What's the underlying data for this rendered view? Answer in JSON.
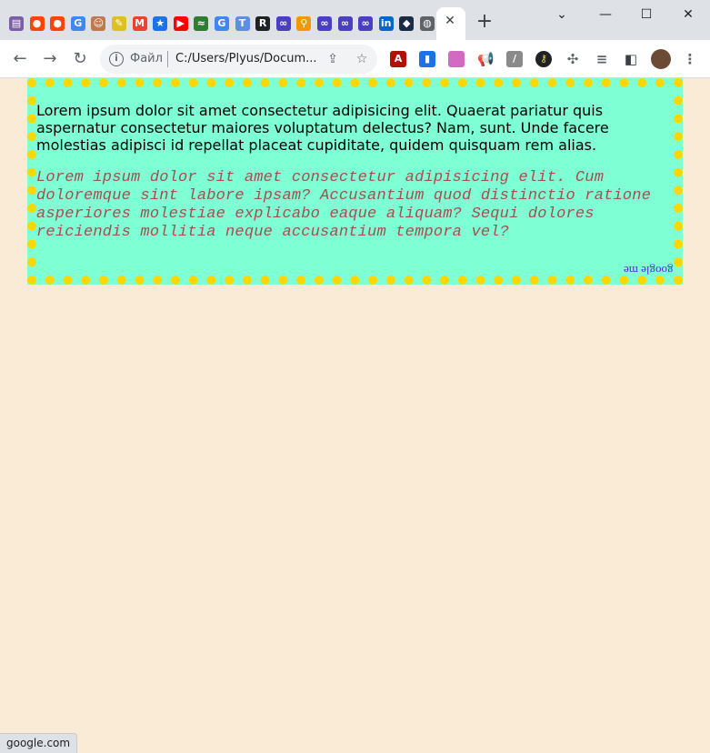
{
  "browser": {
    "tab_count_icons": [
      {
        "name": "library-icon",
        "color": "#7b5ea7",
        "glyph": "▤"
      },
      {
        "name": "reddit-icon",
        "color": "#ff4500",
        "glyph": "●"
      },
      {
        "name": "reddit-icon",
        "color": "#ff4500",
        "glyph": "●"
      },
      {
        "name": "google-icon",
        "color": "#4285f4",
        "glyph": "G"
      },
      {
        "name": "avatar-icon",
        "color": "#c07850",
        "glyph": "☺"
      },
      {
        "name": "chat-icon",
        "color": "#e0c020",
        "glyph": "✎"
      },
      {
        "name": "gmail-icon",
        "color": "#ea4335",
        "glyph": "M"
      },
      {
        "name": "star-icon",
        "color": "#1a73e8",
        "glyph": "★"
      },
      {
        "name": "youtube-icon",
        "color": "#ff0000",
        "glyph": "▶"
      },
      {
        "name": "dna-icon",
        "color": "#2e7d32",
        "glyph": "≈"
      },
      {
        "name": "google-icon",
        "color": "#4285f4",
        "glyph": "G"
      },
      {
        "name": "t-icon",
        "color": "#5c8fe0",
        "glyph": "T"
      },
      {
        "name": "r-icon",
        "color": "#202124",
        "glyph": "R"
      },
      {
        "name": "link-icon",
        "color": "#4a3fc0",
        "glyph": "∞"
      },
      {
        "name": "maps-pin-icon",
        "color": "#f29900",
        "glyph": "⚲"
      },
      {
        "name": "link-icon",
        "color": "#4a3fc0",
        "glyph": "∞"
      },
      {
        "name": "link-icon",
        "color": "#4a3fc0",
        "glyph": "∞"
      },
      {
        "name": "link-icon",
        "color": "#4a3fc0",
        "glyph": "∞"
      },
      {
        "name": "linkedin-icon",
        "color": "#0a66c2",
        "glyph": "in"
      },
      {
        "name": "dark-cube-icon",
        "color": "#1c2b45",
        "glyph": "◆"
      },
      {
        "name": "globe-icon",
        "color": "#5f6368",
        "glyph": "◍"
      }
    ],
    "active_tab_close": "✕",
    "new_tab": "+",
    "window_controls": {
      "minimize": "—",
      "maximize": "☐",
      "close": "✕",
      "tab_search": "⌄"
    },
    "nav": {
      "back": "←",
      "forward": "→",
      "reload": "↻"
    },
    "omnibox": {
      "security_label": "Файл",
      "url": "C:/Users/Plyus/Docum..."
    },
    "status_text": "google.com"
  },
  "page": {
    "paragraph_1": "Lorem ipsum dolor sit amet consectetur adipisicing elit. Quaerat pariatur quis aspernatur consectetur maiores voluptatum delectus? Nam, sunt. Unde facere molestias adipisci id repellat placeat cupiditate, quidem quisquam rem alias.",
    "paragraph_2": "Lorem ipsum dolor sit amet consectetur adipisicing elit. Cum doloremque sint labore ipsam? Accusantium quod distinctio ratione asperiores molestiae explicabo eaque aliquam? Sequi dolores reiciendis mollitia neque accusantium tempora vel?",
    "link_text": "google me",
    "colors": {
      "page_background": "#faebd7",
      "box_background": "#7fffd4",
      "border_dots": "#ffd700",
      "italic_text": "#a05050",
      "link": "#4b2bd6"
    }
  }
}
